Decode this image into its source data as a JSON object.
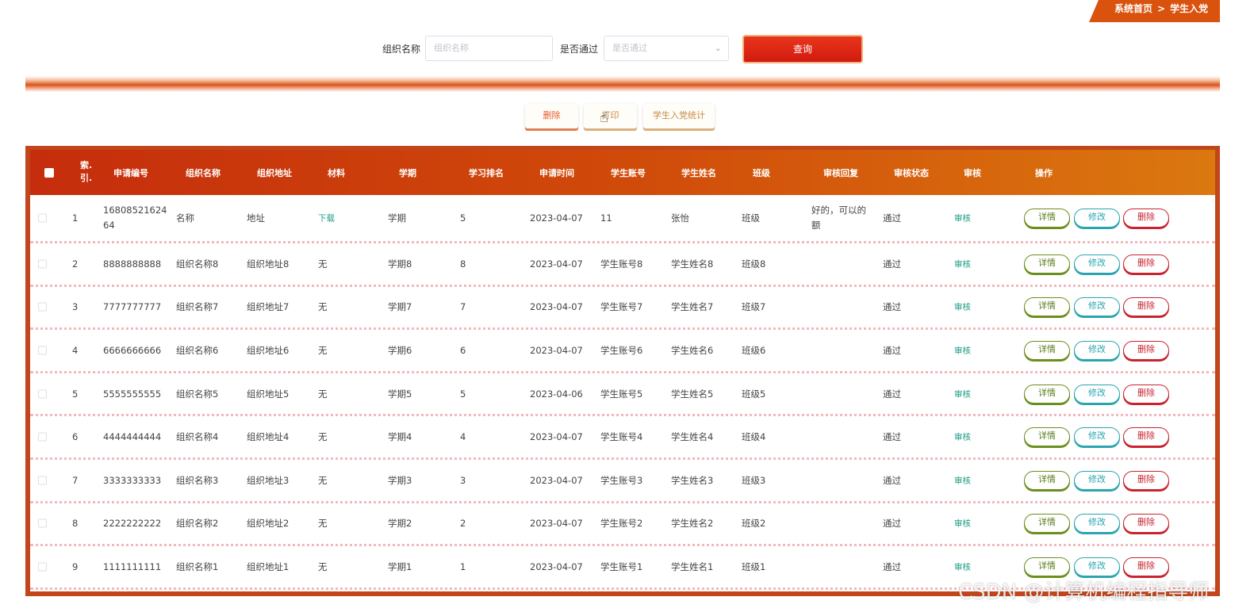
{
  "breadcrumb": {
    "home": "系统首页",
    "separator": ">",
    "current": "学生入党"
  },
  "search": {
    "org_label": "组织名称",
    "org_placeholder": "组织名称",
    "pass_label": "是否通过",
    "pass_placeholder": "是否通过",
    "query_label": "查询"
  },
  "actions": {
    "delete": "删除",
    "print": "打印",
    "stats": "学生入党统计"
  },
  "table": {
    "headers": {
      "index": [
        "索.",
        "引."
      ],
      "app_no": "申请编号",
      "org_name": "组织名称",
      "org_addr": "组织地址",
      "material": "材料",
      "term": "学期",
      "rank": "学习排名",
      "apply_time": "申请时间",
      "account": "学生账号",
      "student_name": "学生姓名",
      "class": "班级",
      "reply": "审核回复",
      "status": "审核状态",
      "audit": "审核",
      "ops": "操作"
    },
    "row_buttons": {
      "detail": "详情",
      "edit": "修改",
      "delete": "删除"
    },
    "rows": [
      {
        "index": "1",
        "app_no": "16808521624 64",
        "org_name": "名称",
        "org_addr": "地址",
        "material": "下载",
        "term": "学期",
        "rank": "5",
        "apply_time": "2023-04-07",
        "account": "11",
        "student_name": "张怡",
        "class": "班级",
        "reply": "好的，可以的额",
        "status": "通过",
        "audit": "审核"
      },
      {
        "index": "2",
        "app_no": "8888888888",
        "org_name": "组织名称8",
        "org_addr": "组织地址8",
        "material": "无",
        "term": "学期8",
        "rank": "8",
        "apply_time": "2023-04-07",
        "account": "学生账号8",
        "student_name": "学生姓名8",
        "class": "班级8",
        "reply": "",
        "status": "通过",
        "audit": "审核"
      },
      {
        "index": "3",
        "app_no": "7777777777",
        "org_name": "组织名称7",
        "org_addr": "组织地址7",
        "material": "无",
        "term": "学期7",
        "rank": "7",
        "apply_time": "2023-04-07",
        "account": "学生账号7",
        "student_name": "学生姓名7",
        "class": "班级7",
        "reply": "",
        "status": "通过",
        "audit": "审核"
      },
      {
        "index": "4",
        "app_no": "6666666666",
        "org_name": "组织名称6",
        "org_addr": "组织地址6",
        "material": "无",
        "term": "学期6",
        "rank": "6",
        "apply_time": "2023-04-07",
        "account": "学生账号6",
        "student_name": "学生姓名6",
        "class": "班级6",
        "reply": "",
        "status": "通过",
        "audit": "审核"
      },
      {
        "index": "5",
        "app_no": "5555555555",
        "org_name": "组织名称5",
        "org_addr": "组织地址5",
        "material": "无",
        "term": "学期5",
        "rank": "5",
        "apply_time": "2023-04-06",
        "account": "学生账号5",
        "student_name": "学生姓名5",
        "class": "班级5",
        "reply": "",
        "status": "通过",
        "audit": "审核"
      },
      {
        "index": "6",
        "app_no": "4444444444",
        "org_name": "组织名称4",
        "org_addr": "组织地址4",
        "material": "无",
        "term": "学期4",
        "rank": "4",
        "apply_time": "2023-04-07",
        "account": "学生账号4",
        "student_name": "学生姓名4",
        "class": "班级4",
        "reply": "",
        "status": "通过",
        "audit": "审核"
      },
      {
        "index": "7",
        "app_no": "3333333333",
        "org_name": "组织名称3",
        "org_addr": "组织地址3",
        "material": "无",
        "term": "学期3",
        "rank": "3",
        "apply_time": "2023-04-07",
        "account": "学生账号3",
        "student_name": "学生姓名3",
        "class": "班级3",
        "reply": "",
        "status": "通过",
        "audit": "审核"
      },
      {
        "index": "8",
        "app_no": "2222222222",
        "org_name": "组织名称2",
        "org_addr": "组织地址2",
        "material": "无",
        "term": "学期2",
        "rank": "2",
        "apply_time": "2023-04-07",
        "account": "学生账号2",
        "student_name": "学生姓名2",
        "class": "班级2",
        "reply": "",
        "status": "通过",
        "audit": "审核"
      },
      {
        "index": "9",
        "app_no": "1111111111",
        "org_name": "组织名称1",
        "org_addr": "组织地址1",
        "material": "无",
        "term": "学期1",
        "rank": "1",
        "apply_time": "2023-04-07",
        "account": "学生账号1",
        "student_name": "学生姓名1",
        "class": "班级1",
        "reply": "",
        "status": "通过",
        "audit": "审核"
      }
    ]
  },
  "watermark": "CSDN @计算机编程指导师",
  "icons": {
    "select_chevron": "chevron-down-icon",
    "cursor": "hand-pointer-icon"
  }
}
